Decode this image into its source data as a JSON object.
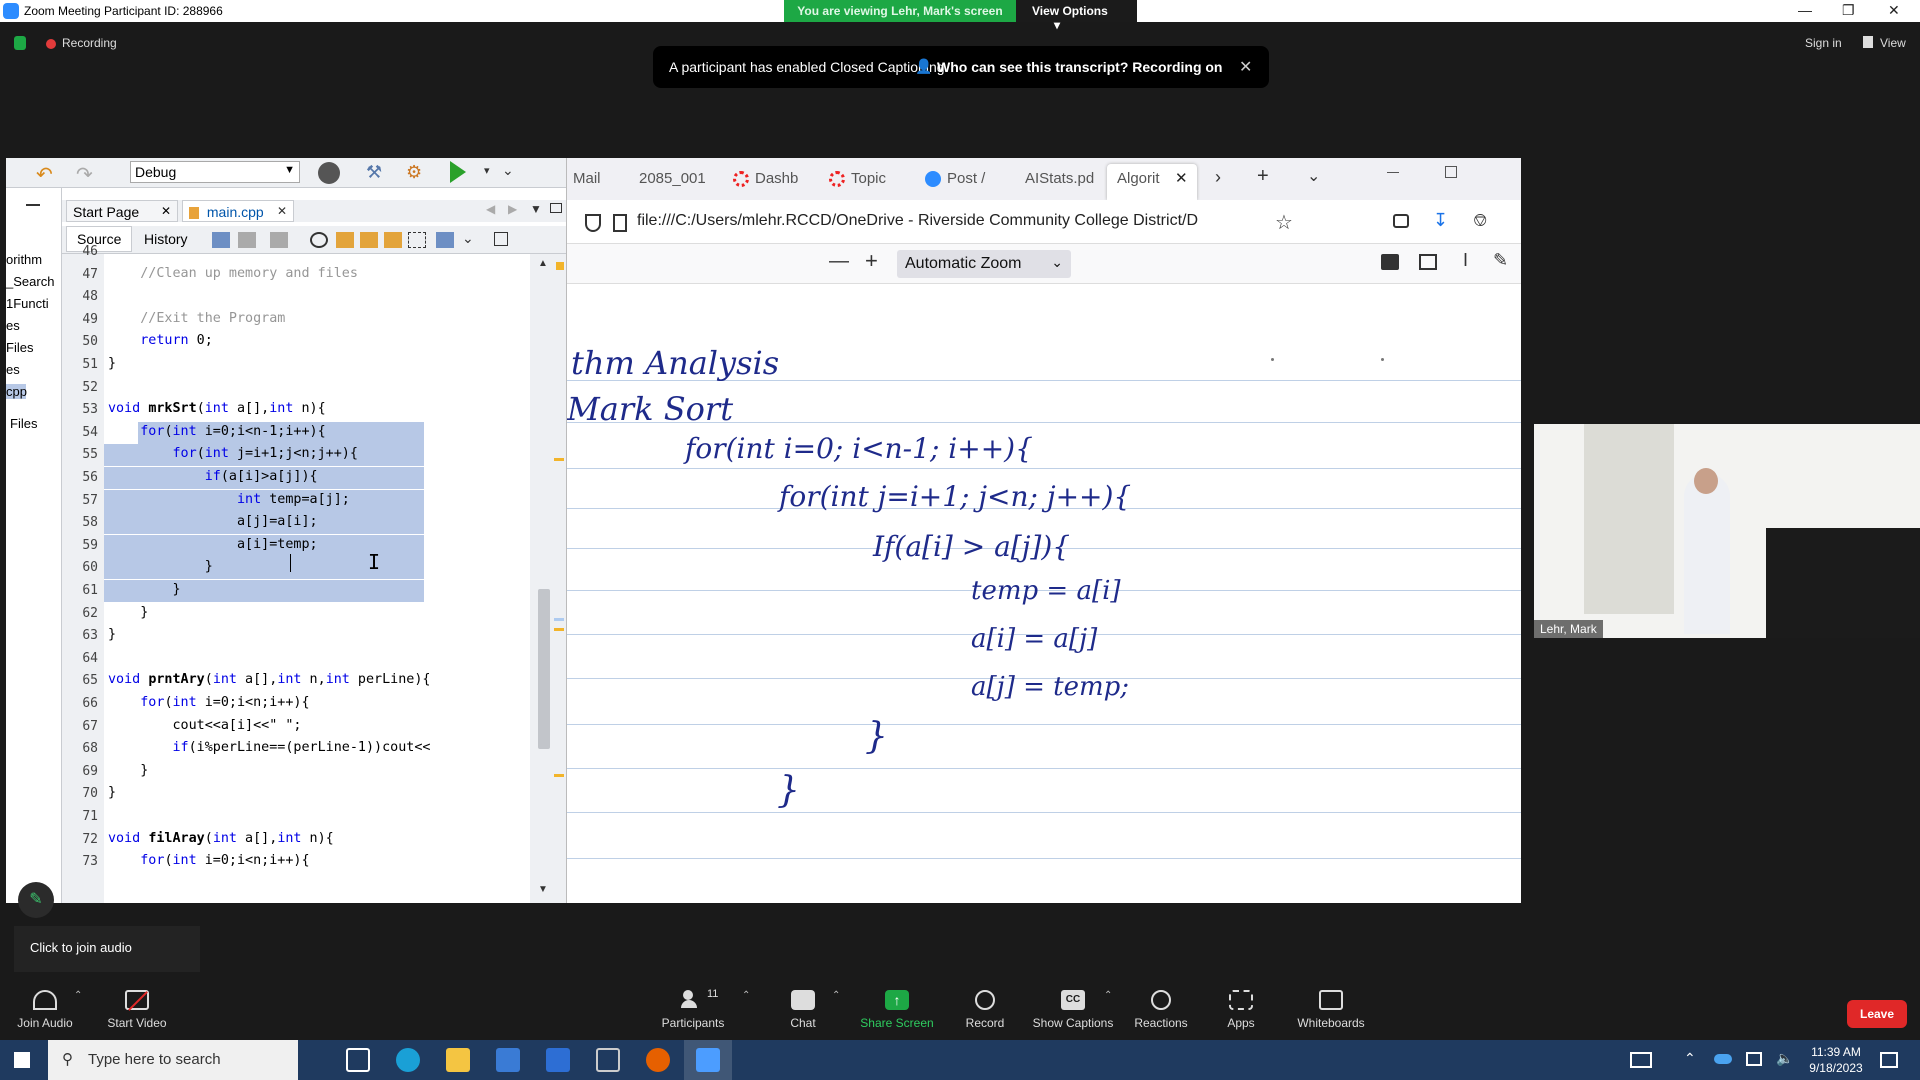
{
  "window": {
    "title": "Zoom Meeting Participant ID: 288966",
    "viewing_text": "You are viewing Lehr, Mark's screen",
    "view_options": "View Options"
  },
  "meeting": {
    "recording": "Recording",
    "cc_message": "A participant has enabled Closed Captioning",
    "cc_link": "Who can see this transcript? Recording on",
    "sign_in": "Sign in",
    "view": "View"
  },
  "ide": {
    "config": "Debug",
    "tabs": [
      "Start Page",
      "main.cpp"
    ],
    "source_tab": "Source",
    "history_tab": "History",
    "project_items": [
      "orithm",
      "_Search",
      "1Functi",
      "es",
      "Files",
      "es",
      "cpp",
      "Files"
    ],
    "code_lines": [
      {
        "n": "46",
        "t": ""
      },
      {
        "n": "47",
        "t": "    //Clean up memory and files"
      },
      {
        "n": "48",
        "t": ""
      },
      {
        "n": "49",
        "t": "    //Exit the Program"
      },
      {
        "n": "50",
        "t": "    return 0;"
      },
      {
        "n": "51",
        "t": "}"
      },
      {
        "n": "52",
        "t": ""
      },
      {
        "n": "53",
        "t": "void mrkSrt(int a[],int n){"
      },
      {
        "n": "54",
        "t": "    for(int i=0;i<n-1;i++){"
      },
      {
        "n": "55",
        "t": "        for(int j=i+1;j<n;j++){"
      },
      {
        "n": "56",
        "t": "            if(a[i]>a[j]){"
      },
      {
        "n": "57",
        "t": "                int temp=a[j];"
      },
      {
        "n": "58",
        "t": "                a[j]=a[i];"
      },
      {
        "n": "59",
        "t": "                a[i]=temp;"
      },
      {
        "n": "60",
        "t": "            }"
      },
      {
        "n": "61",
        "t": "        }"
      },
      {
        "n": "62",
        "t": "    }"
      },
      {
        "n": "63",
        "t": "}"
      },
      {
        "n": "64",
        "t": ""
      },
      {
        "n": "65",
        "t": "void prntAry(int a[],int n,int perLine){"
      },
      {
        "n": "66",
        "t": "    for(int i=0;i<n;i++){"
      },
      {
        "n": "67",
        "t": "        cout<<a[i]<<\" \";"
      },
      {
        "n": "68",
        "t": "        if(i%perLine==(perLine-1))cout<<"
      },
      {
        "n": "69",
        "t": "    }"
      },
      {
        "n": "70",
        "t": "}"
      },
      {
        "n": "71",
        "t": ""
      },
      {
        "n": "72",
        "t": "void filAray(int a[],int n){"
      },
      {
        "n": "73",
        "t": "    for(int i=0;i<n;i++){"
      }
    ]
  },
  "browser": {
    "tabs": [
      "Mail",
      "2085_001",
      "Dashb",
      "Topic",
      "Post /",
      "AIStats.pd",
      "Algorit"
    ],
    "url": "file:///C:/Users/mlehr.RCCD/OneDrive - Riverside Community College District/D",
    "zoom": "Automatic Zoom",
    "handwriting": [
      "thm Analysis",
      "Mark Sort",
      "for(int i=0; i<n-1; i++){",
      "for(int j=i+1; j<n; j++){",
      "If(a[i] > a[j]){",
      "temp = a[i]",
      "a[i] = a[j]",
      "a[j] = temp;",
      "}",
      "}"
    ]
  },
  "video": {
    "name": "Lehr, Mark"
  },
  "audio_popup": "Click to join audio",
  "toolbar": {
    "join_audio": "Join Audio",
    "start_video": "Start Video",
    "participants": "Participants",
    "participants_count": "11",
    "chat": "Chat",
    "share_screen": "Share Screen",
    "record": "Record",
    "show_captions": "Show Captions",
    "reactions": "Reactions",
    "apps": "Apps",
    "whiteboards": "Whiteboards",
    "leave": "Leave"
  },
  "taskbar": {
    "search_placeholder": "Type here to search",
    "time": "11:39 AM",
    "date": "9/18/2023"
  },
  "colors": {
    "zoom_blue": "#2d8cff",
    "share_green": "#1da845",
    "leave_red": "#e02828",
    "selection": "#b7c8e6"
  }
}
